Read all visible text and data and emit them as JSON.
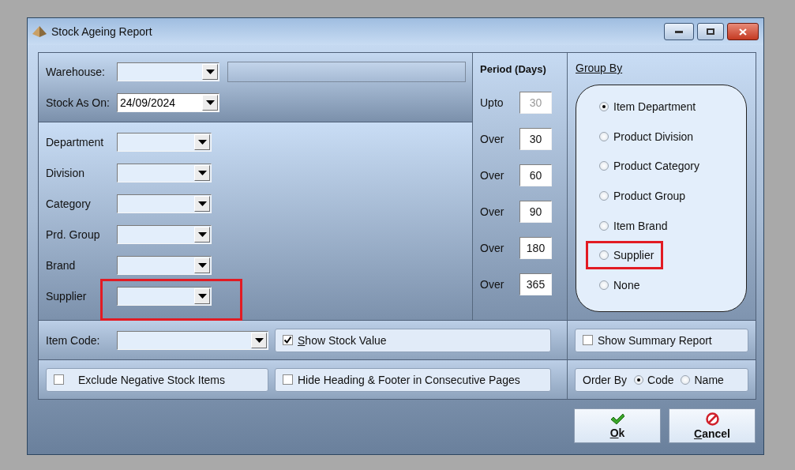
{
  "window": {
    "title": "Stock Ageing Report"
  },
  "header_fields": [
    {
      "kind": "combo",
      "label": "Warehouse:"
    },
    {
      "kind": "date",
      "label": "Stock As On:",
      "value": "24/09/2024"
    }
  ],
  "filters": [
    {
      "label": "Department",
      "highlighted": false
    },
    {
      "label": "Division",
      "highlighted": false
    },
    {
      "label": "Category",
      "highlighted": false
    },
    {
      "label": "Prd. Group",
      "highlighted": false
    },
    {
      "label": "Brand",
      "highlighted": false
    },
    {
      "label": "Supplier",
      "highlighted": true
    }
  ],
  "period": {
    "title": "Period (Days)",
    "rows": [
      {
        "label": "Upto",
        "value": "30",
        "disabled": true
      },
      {
        "label": "Over",
        "value": "30",
        "disabled": false
      },
      {
        "label": "Over",
        "value": "60",
        "disabled": false
      },
      {
        "label": "Over",
        "value": "90",
        "disabled": false
      },
      {
        "label": "Over",
        "value": "180",
        "disabled": false
      },
      {
        "label": "Over",
        "value": "365",
        "disabled": false
      }
    ]
  },
  "group_by": {
    "title": "Group By",
    "options": [
      {
        "label": "Item Department",
        "selected": true,
        "highlighted": false
      },
      {
        "label": "Product Division",
        "selected": false,
        "highlighted": false
      },
      {
        "label": "Product Category",
        "selected": false,
        "highlighted": false
      },
      {
        "label": "Product Group",
        "selected": false,
        "highlighted": false
      },
      {
        "label": "Item Brand",
        "selected": false,
        "highlighted": false
      },
      {
        "label": "Supplier",
        "selected": false,
        "highlighted": true
      },
      {
        "label": "None",
        "selected": false,
        "highlighted": false
      }
    ]
  },
  "item_code": {
    "label": "Item Code:"
  },
  "options": [
    {
      "label": "Show Stock Value",
      "checked": true,
      "access_key_underlined": true
    },
    {
      "label": "Show Summary Report",
      "checked": false,
      "access_key_underlined": false
    },
    {
      "label": "Exclude Negative Stock Items",
      "checked": false,
      "access_key_underlined": false
    },
    {
      "label": "Hide Heading & Footer in Consecutive Pages",
      "checked": false,
      "access_key_underlined": false
    }
  ],
  "order_by": {
    "label": "Order By",
    "options": [
      {
        "label": "Code",
        "selected": true
      },
      {
        "label": "Name",
        "selected": false
      }
    ]
  },
  "buttons": [
    {
      "kind": "ok",
      "label": "Ok",
      "access_key_underlined": true
    },
    {
      "kind": "cancel",
      "label": "Cancel",
      "access_key_underlined": true
    }
  ]
}
